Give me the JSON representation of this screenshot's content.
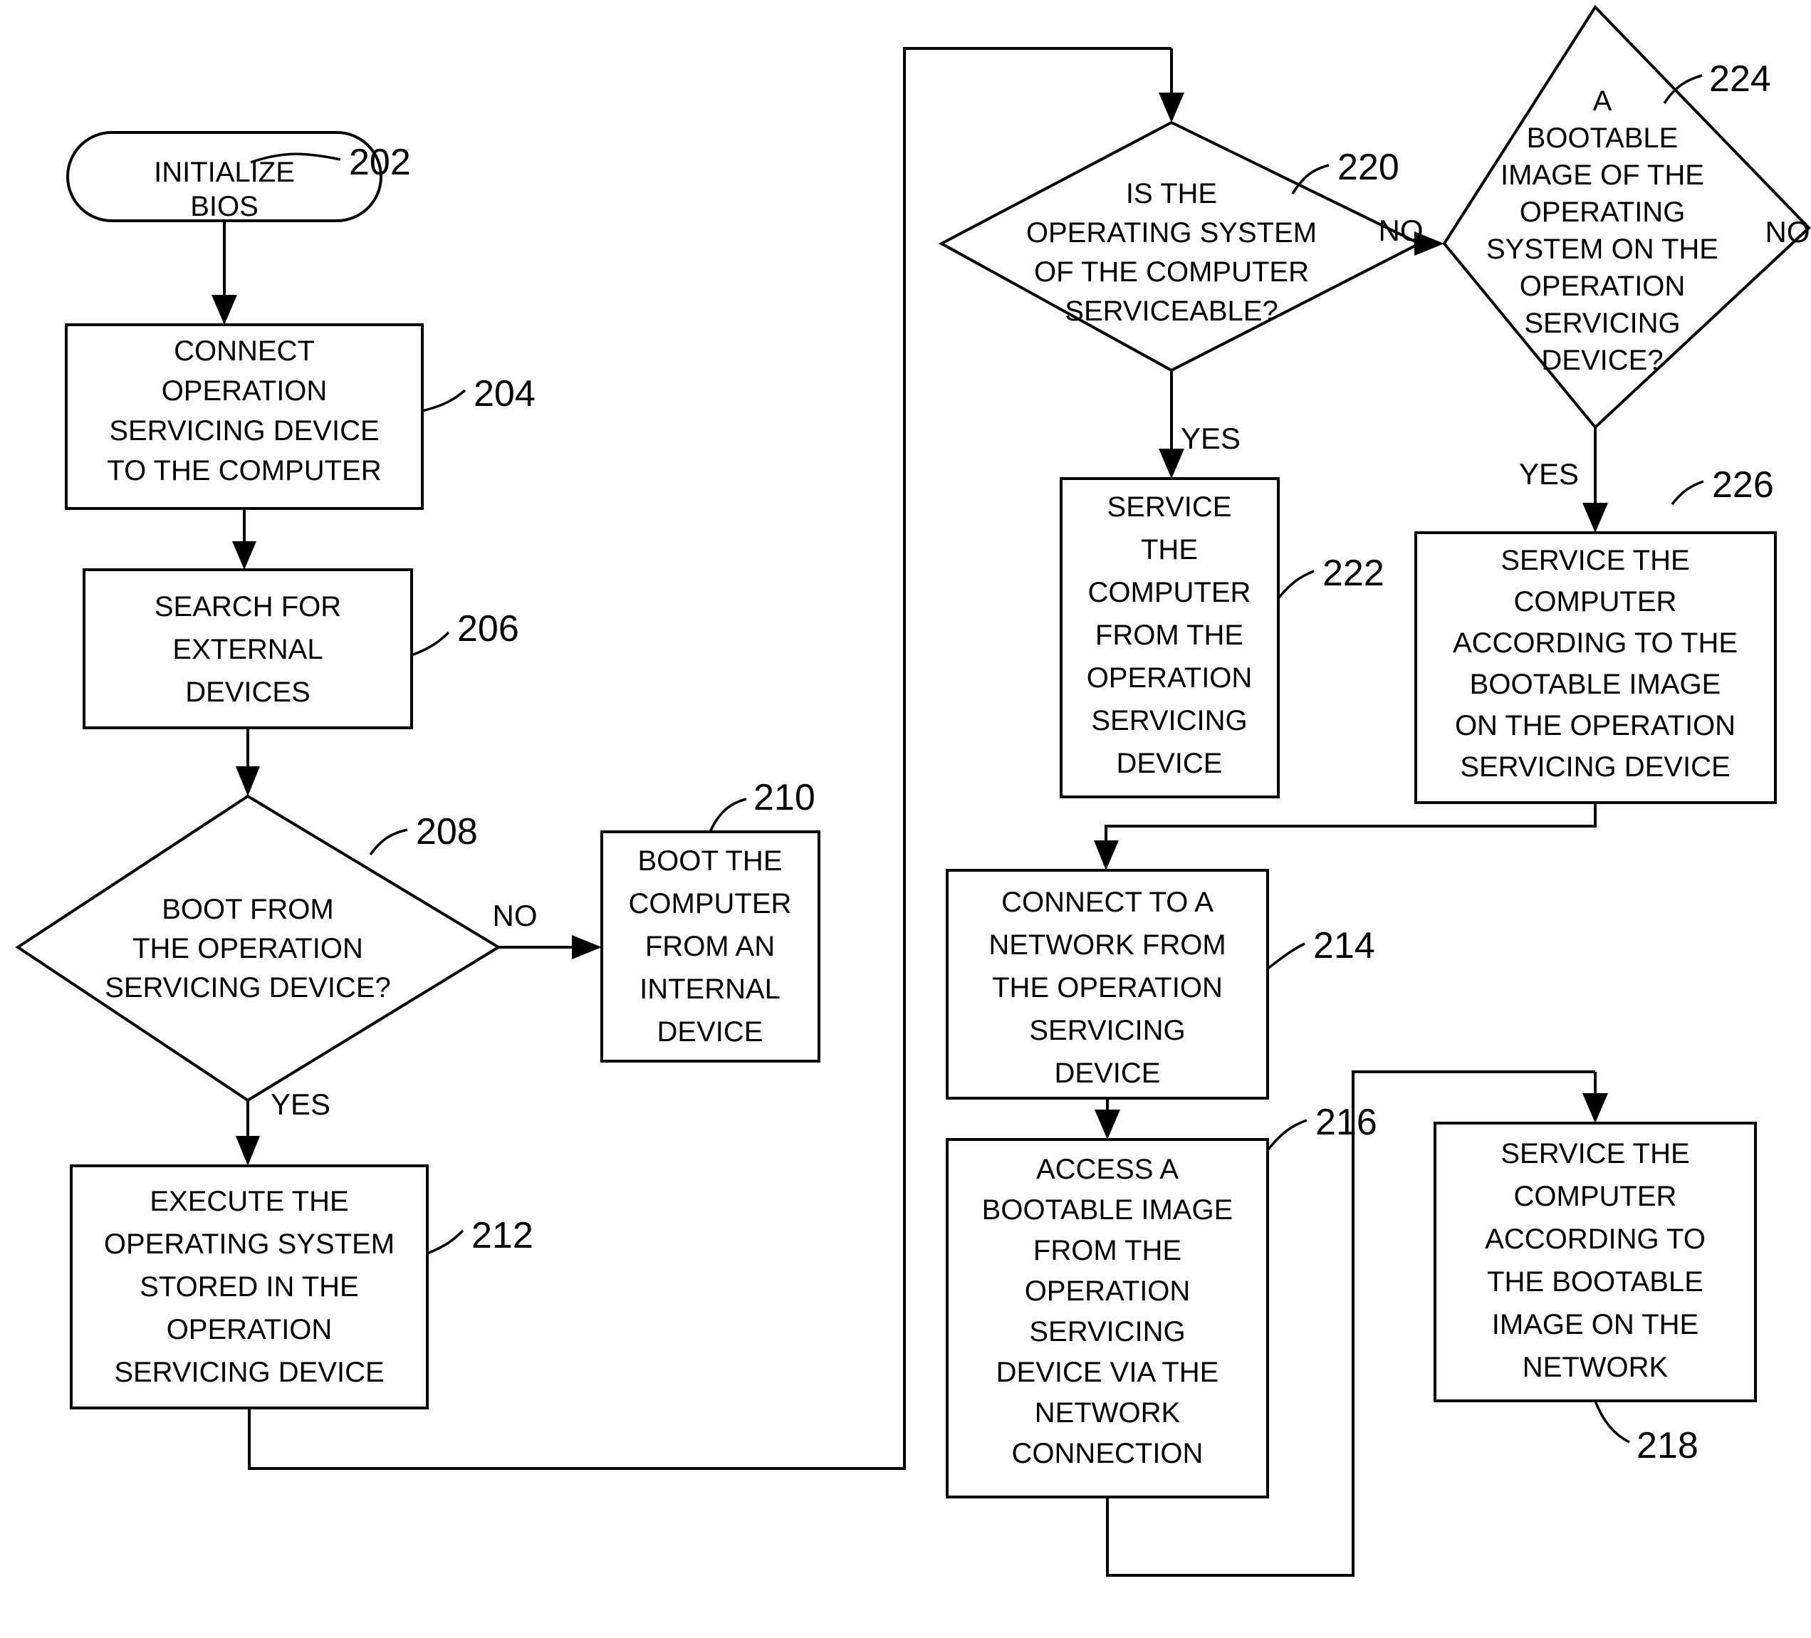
{
  "figure": {
    "type": "patent-flowchart",
    "background_color": "#ffffff",
    "line_color": "#000000",
    "text_color": "#000000"
  },
  "nodes": {
    "n202": {
      "ref": "202",
      "shape": "terminator",
      "lines": [
        "INITIALIZE",
        "BIOS"
      ]
    },
    "n204": {
      "ref": "204",
      "shape": "process",
      "lines": [
        "CONNECT",
        "OPERATION",
        "SERVICING DEVICE",
        "TO THE COMPUTER"
      ]
    },
    "n206": {
      "ref": "206",
      "shape": "process",
      "lines": [
        "SEARCH FOR",
        "EXTERNAL",
        "DEVICES"
      ]
    },
    "n208": {
      "ref": "208",
      "shape": "decision",
      "lines": [
        "BOOT FROM",
        "THE OPERATION",
        "SERVICING DEVICE?"
      ]
    },
    "n210": {
      "ref": "210",
      "shape": "process",
      "lines": [
        "BOOT THE",
        "COMPUTER",
        "FROM AN",
        "INTERNAL",
        "DEVICE"
      ]
    },
    "n212": {
      "ref": "212",
      "shape": "process",
      "lines": [
        "EXECUTE THE",
        "OPERATING SYSTEM",
        "STORED IN THE",
        "OPERATION",
        "SERVICING DEVICE"
      ]
    },
    "n214": {
      "ref": "214",
      "shape": "process",
      "lines": [
        "CONNECT TO A",
        "NETWORK FROM",
        "THE OPERATION",
        "SERVICING",
        "DEVICE"
      ]
    },
    "n216": {
      "ref": "216",
      "shape": "process",
      "lines": [
        "ACCESS A",
        "BOOTABLE IMAGE",
        "FROM THE",
        "OPERATION",
        "SERVICING",
        "DEVICE VIA THE",
        "NETWORK",
        "CONNECTION"
      ]
    },
    "n218": {
      "ref": "218",
      "shape": "process",
      "lines": [
        "SERVICE THE",
        "COMPUTER",
        "ACCORDING TO",
        "THE BOOTABLE",
        "IMAGE ON THE",
        "NETWORK"
      ]
    },
    "n220": {
      "ref": "220",
      "shape": "decision",
      "lines": [
        "IS THE",
        "OPERATING SYSTEM",
        "OF THE COMPUTER",
        "SERVICEABLE?"
      ]
    },
    "n222": {
      "ref": "222",
      "shape": "process",
      "lines": [
        "SERVICE",
        "THE",
        "COMPUTER",
        "FROM THE",
        "OPERATION",
        "SERVICING",
        "DEVICE"
      ]
    },
    "n224": {
      "ref": "224",
      "shape": "decision",
      "lines": [
        "A",
        "BOOTABLE",
        "IMAGE OF THE",
        "OPERATING",
        "SYSTEM ON THE",
        "OPERATION",
        "SERVICING",
        "DEVICE?"
      ]
    },
    "n226": {
      "ref": "226",
      "shape": "process",
      "lines": [
        "SERVICE THE",
        "COMPUTER",
        "ACCORDING TO THE",
        "BOOTABLE IMAGE",
        "ON THE OPERATION",
        "SERVICING DEVICE"
      ]
    }
  },
  "branch_labels": {
    "b208_no": "NO",
    "b208_yes": "YES",
    "b220_no": "NO",
    "b220_yes": "YES",
    "b224_no": "NO",
    "b224_yes": "YES"
  }
}
